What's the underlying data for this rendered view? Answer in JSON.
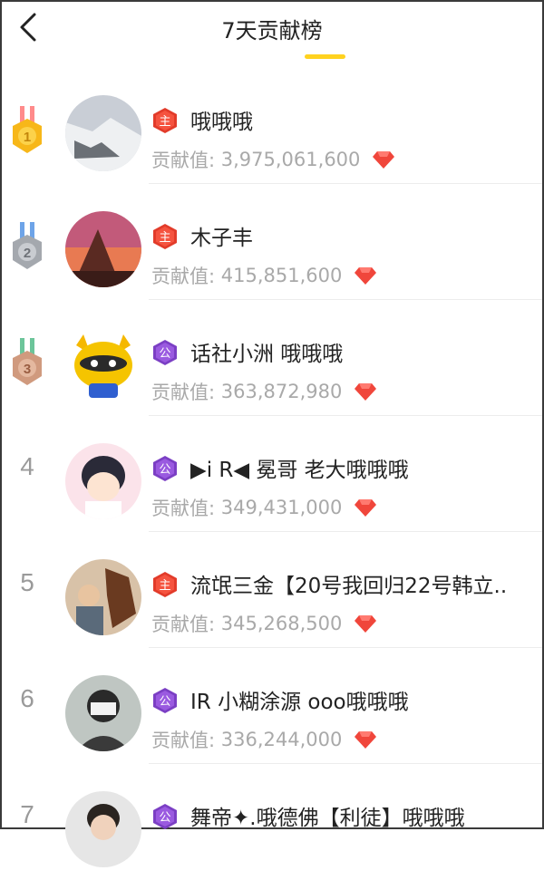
{
  "header": {
    "title": "7天贡献榜",
    "back_icon": "chevron-left-icon"
  },
  "value_label": "贡献值:",
  "colors": {
    "accent": "#ffd21f",
    "gem": "#f0463b",
    "badge_host": "#e23b2a",
    "badge_public": "#8c4bd1"
  },
  "rows": [
    {
      "rank": "1",
      "name": "哦哦哦",
      "value": "3,975,061,600",
      "badge": "主"
    },
    {
      "rank": "2",
      "name": "木子丰",
      "value": "415,851,600",
      "badge": "主"
    },
    {
      "rank": "3",
      "name": "话社小洲 哦哦哦",
      "value": "363,872,980",
      "badge": "公"
    },
    {
      "rank": "4",
      "name": "▶i R◀ 冕哥  老大哦哦哦",
      "value": "349,431,000",
      "badge": "公"
    },
    {
      "rank": "5",
      "name": "流氓三金【20号我回归22号韩立..",
      "value": "345,268,500",
      "badge": "主"
    },
    {
      "rank": "6",
      "name": "IR 小糊涂源 ooo哦哦哦",
      "value": "336,244,000",
      "badge": "公"
    },
    {
      "rank": "7",
      "name": "舞帝✦.哦德佛【利徒】哦哦哦",
      "value": "",
      "badge": "公"
    }
  ]
}
